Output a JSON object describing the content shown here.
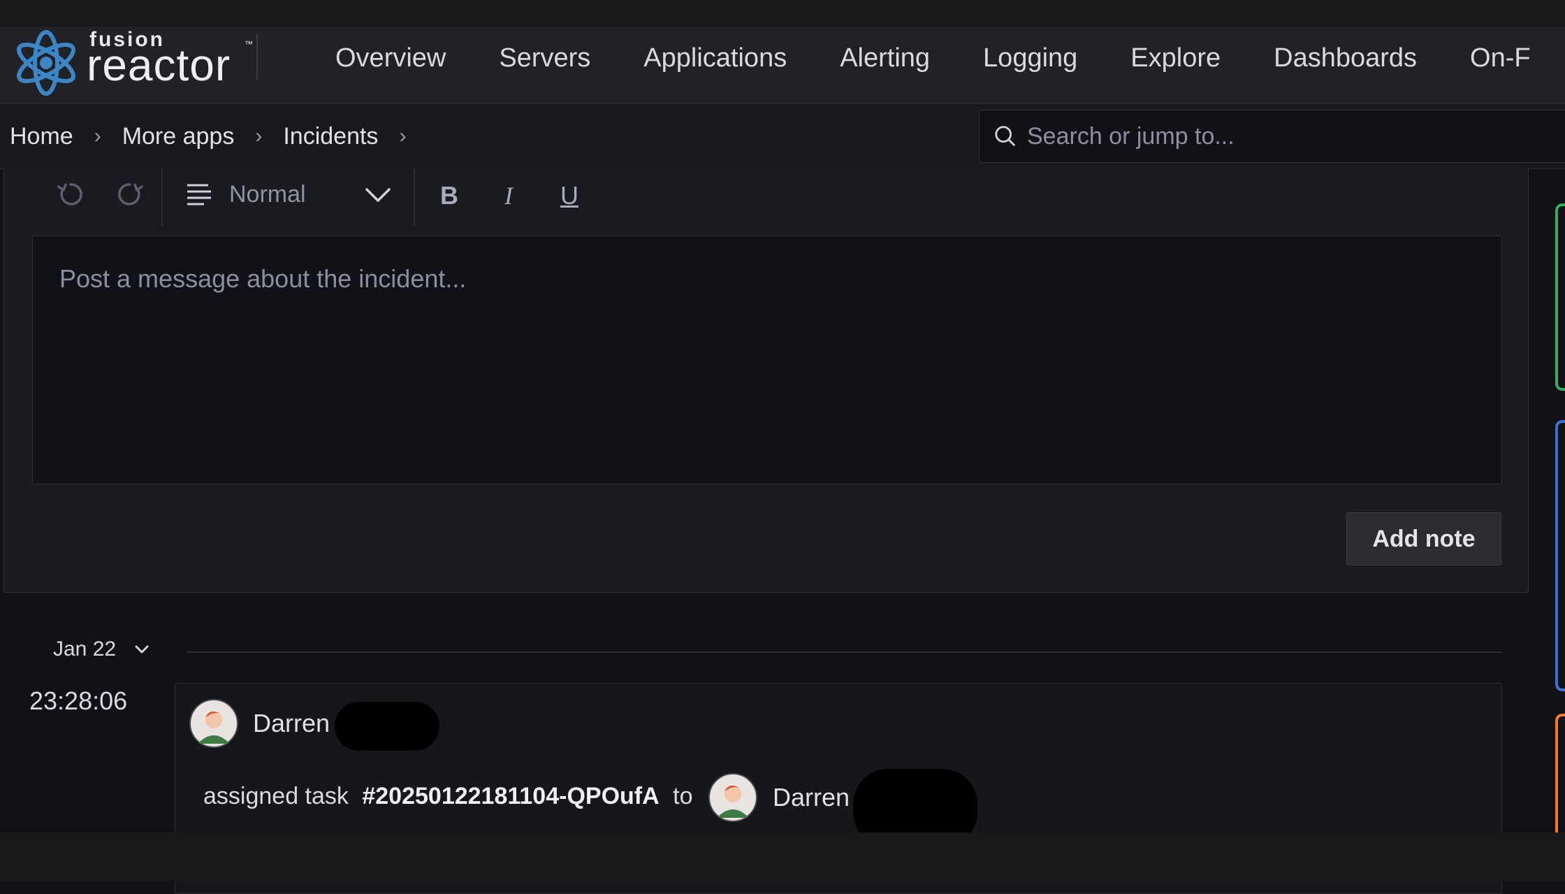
{
  "brand": {
    "logo_small": "fusion",
    "logo_big": "reactor",
    "tm": "™"
  },
  "nav": {
    "items": [
      "Overview",
      "Servers",
      "Applications",
      "Alerting",
      "Logging",
      "Explore",
      "Dashboards",
      "On-F"
    ]
  },
  "breadcrumb": {
    "items": [
      "Home",
      "More apps",
      "Incidents"
    ]
  },
  "search": {
    "placeholder": "Search or jump to..."
  },
  "editor": {
    "format_label": "Normal",
    "placeholder": "Post a message about the incident...",
    "add_note_label": "Add note",
    "tools": {
      "bold": "B",
      "italic": "I",
      "underline": "U"
    }
  },
  "timeline": {
    "date_label": "Jan 22",
    "time": "23:28:06",
    "author": "Darren",
    "action_prefix": "assigned task",
    "task_id": "#20250122181104-QPOufA",
    "action_to": "to",
    "assignee": "Darren"
  },
  "colors": {
    "rail_green": "#3dab5a",
    "rail_blue": "#3d71d9",
    "rail_orange": "#f57a2a",
    "logo_blue": "#3d86c6"
  }
}
